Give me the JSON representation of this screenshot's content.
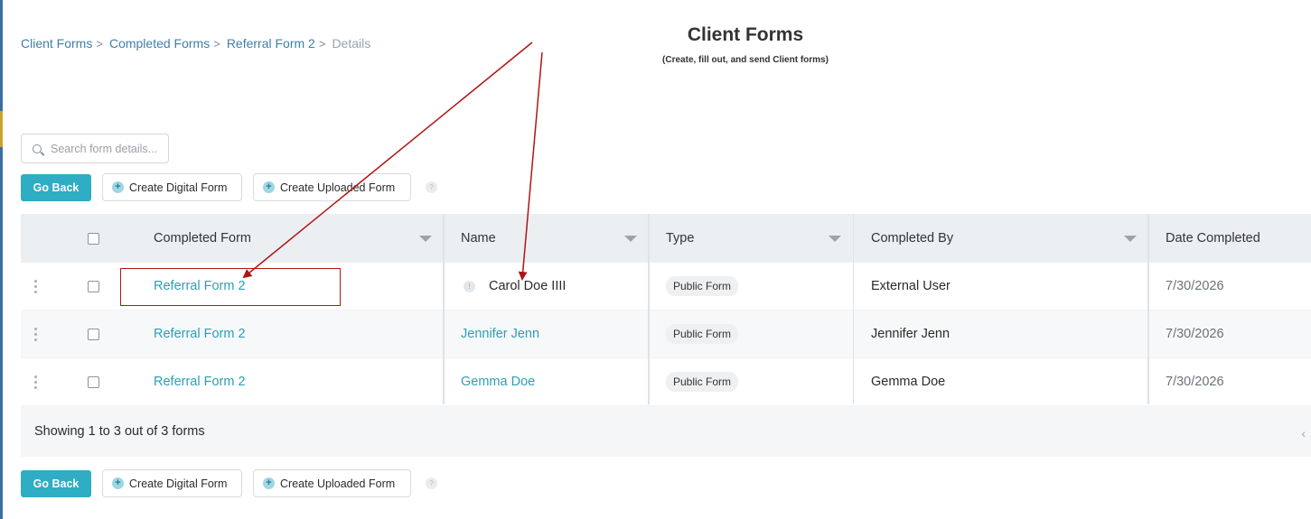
{
  "breadcrumb": {
    "items": [
      "Client Forms",
      "Completed Forms",
      "Referral Form 2"
    ],
    "current": "Details",
    "separator": ">"
  },
  "header": {
    "title": "Client Forms",
    "subtitle": "(Create, fill out, and send Client forms)"
  },
  "search": {
    "placeholder": "Search form details..."
  },
  "toolbar": {
    "go_back": "Go Back",
    "create_digital": "Create Digital Form",
    "create_uploaded": "Create Uploaded Form",
    "plus_glyph": "+",
    "help_glyph": "?"
  },
  "table": {
    "columns": [
      "Completed Form",
      "Name",
      "Type",
      "Completed By",
      "Date Completed"
    ],
    "rows": [
      {
        "form": "Referral Form 2",
        "name": "Carol Doe IIII",
        "name_is_link": false,
        "info_glyph": "!",
        "type": "Public Form",
        "completed_by": "External User",
        "date": "7/30/2026"
      },
      {
        "form": "Referral Form 2",
        "name": "Jennifer Jenn",
        "name_is_link": true,
        "type": "Public Form",
        "completed_by": "Jennifer Jenn",
        "date": "7/30/2026"
      },
      {
        "form": "Referral Form 2",
        "name": "Gemma Doe",
        "name_is_link": true,
        "type": "Public Form",
        "completed_by": "Gemma Doe",
        "date": "7/30/2026"
      }
    ],
    "footer_text": "Showing 1 to 3 out of 3 forms",
    "scroll_glyph": "‹"
  },
  "colors": {
    "accent": "#2eadc4",
    "link": "#2b9fb8",
    "breadcrumb_link": "#3f7fa8",
    "annotation": "#b01515"
  },
  "icons": [
    "search-icon",
    "plus-icon",
    "help-icon",
    "sort-icon",
    "kebab-icon",
    "info-icon",
    "chevron-left-icon"
  ]
}
